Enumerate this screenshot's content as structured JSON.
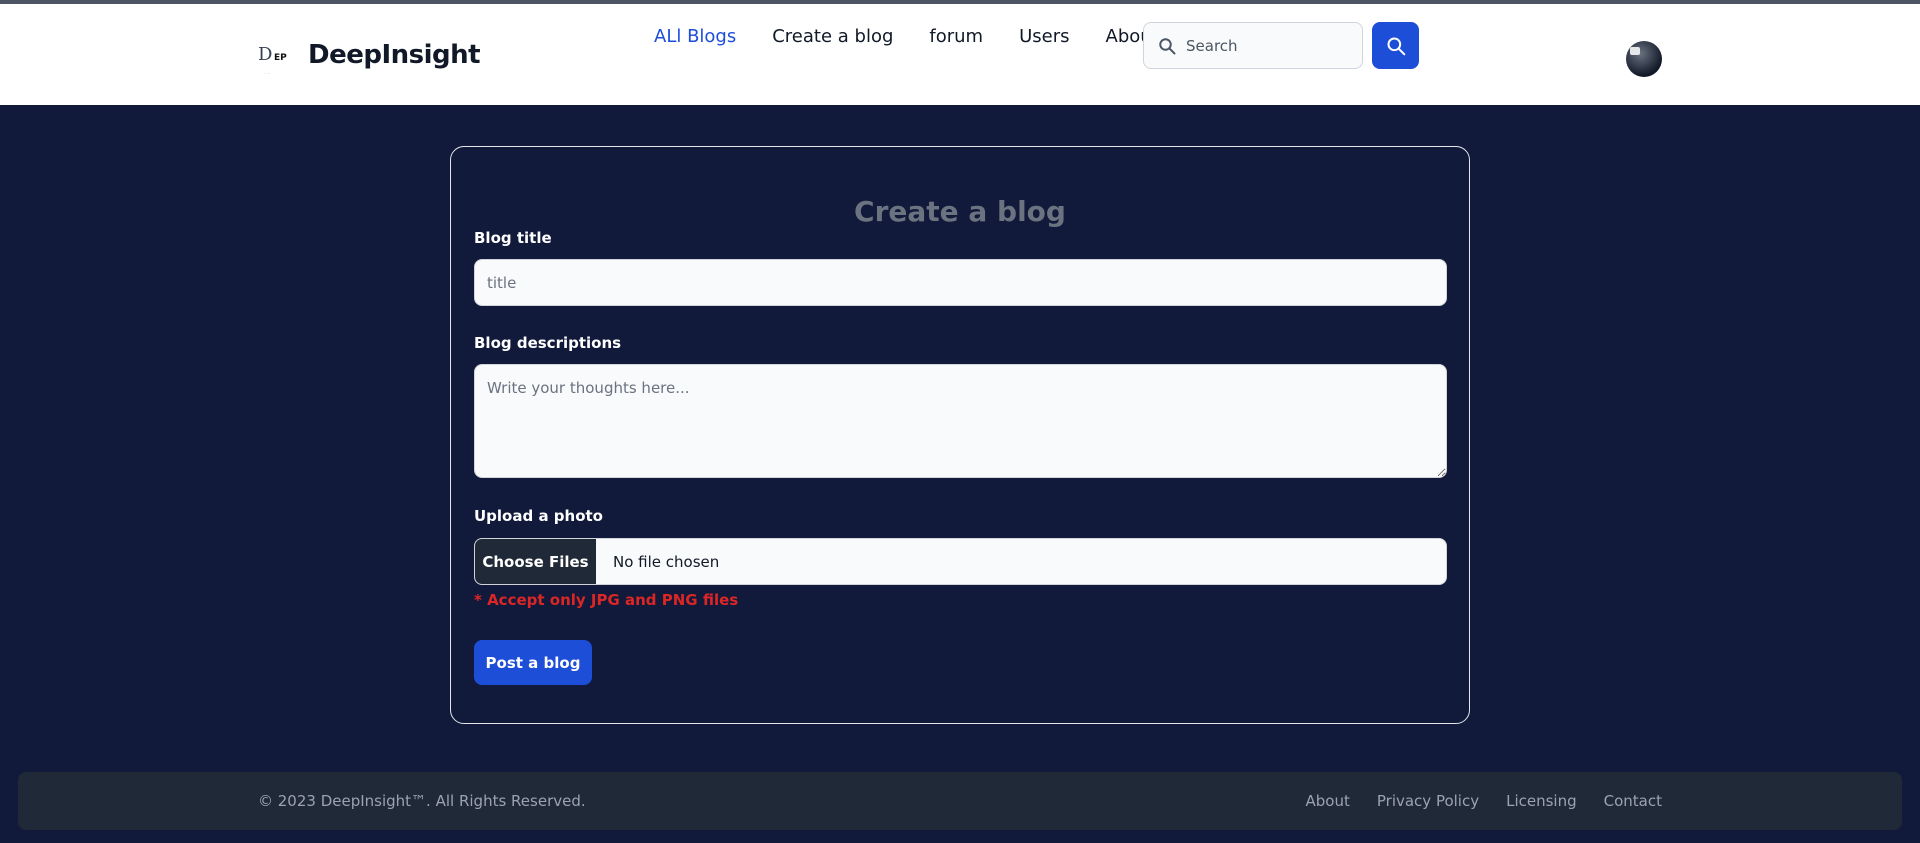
{
  "header": {
    "brand": "DeepInsight",
    "logo_text": "D",
    "logo_mark": "EP",
    "nav": [
      "ALl Blogs",
      "Create a blog",
      "forum",
      "Users",
      "About"
    ],
    "search_placeholder": "Search",
    "icons": {
      "search": "search-icon",
      "search_button": "search-icon",
      "avatar": "user-avatar"
    }
  },
  "form": {
    "title": "Create a blog",
    "blog_title_label": "Blog title",
    "blog_title_placeholder": "title",
    "description_label": "Blog descriptions",
    "description_placeholder": "Write your thoughts here...",
    "upload_label": "Upload a photo",
    "choose_files": "Choose Files",
    "file_status": "No file chosen",
    "file_hint": "* Accept only JPG and PNG files",
    "submit": "Post a blog"
  },
  "footer": {
    "copyright": "© 2023 DeepInsight™. All Rights Reserved.",
    "links": [
      "About",
      "Privacy Policy",
      "Licensing",
      "Contact"
    ]
  },
  "colors": {
    "page_bg": "#111a3a",
    "accent": "#1d4ed8",
    "warning": "#dc2626",
    "footer_bg": "#1f2937"
  }
}
